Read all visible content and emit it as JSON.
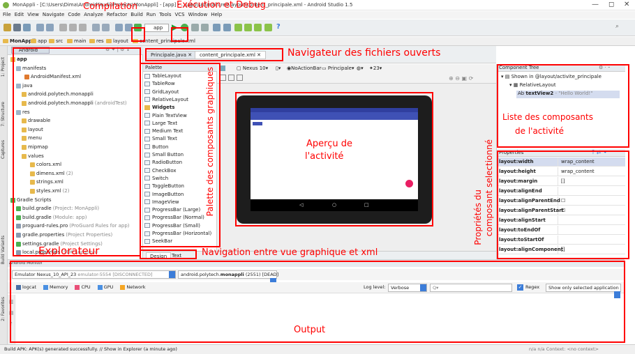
{
  "window": {
    "title": "MonAppli - [C:\\Users\\Dima\\AndroidStudioProjects\\MonAppli] - [app] - ...\\app\\src\\main\\res\\layout\\content_principale.xml - Android Studio 1.5",
    "min": "—",
    "max": "◻",
    "close": "✕"
  },
  "menu": [
    "File",
    "Edit",
    "View",
    "Navigate",
    "Code",
    "Analyze",
    "Refactor",
    "Build",
    "Run",
    "Tools",
    "VCS",
    "Window",
    "Help"
  ],
  "toolbar": {
    "config": "app"
  },
  "breadcrumbs": [
    "MonAppli",
    "app",
    "src",
    "main",
    "res",
    "layout",
    "content_principale.xml"
  ],
  "project": {
    "selector": "Android",
    "items": [
      {
        "label": "app",
        "extra": ""
      },
      {
        "label": "manifests",
        "extra": ""
      },
      {
        "label": "AndroidManifest.xml",
        "extra": ""
      },
      {
        "label": "java",
        "extra": ""
      },
      {
        "label": "android.polytech.monappli",
        "extra": ""
      },
      {
        "label": "android.polytech.monappli",
        "extra": "(androidTest)"
      },
      {
        "label": "res",
        "extra": ""
      },
      {
        "label": "drawable",
        "extra": ""
      },
      {
        "label": "layout",
        "extra": ""
      },
      {
        "label": "menu",
        "extra": ""
      },
      {
        "label": "mipmap",
        "extra": ""
      },
      {
        "label": "values",
        "extra": ""
      },
      {
        "label": "colors.xml",
        "extra": ""
      },
      {
        "label": "dimens.xml",
        "extra": "(2)"
      },
      {
        "label": "strings.xml",
        "extra": ""
      },
      {
        "label": "styles.xml",
        "extra": "(2)"
      },
      {
        "label": "Gradle Scripts",
        "extra": ""
      },
      {
        "label": "build.gradle",
        "extra": "(Project: MonAppli)"
      },
      {
        "label": "build.gradle",
        "extra": "(Module: app)"
      },
      {
        "label": "proguard-rules.pro",
        "extra": "(ProGuard Rules for app)"
      },
      {
        "label": "gradle.properties",
        "extra": "(Project Properties)"
      },
      {
        "label": "settings.gradle",
        "extra": "(Project Settings)"
      },
      {
        "label": "local.properties",
        "extra": "(SDK Location)"
      }
    ]
  },
  "left_tabs": [
    "1: Project",
    "7: Structure",
    "Captures",
    "Build Variants",
    "2: Favorites"
  ],
  "editor_tabs": [
    "Principale.java",
    "content_principale.xml"
  ],
  "palette": {
    "title": "Palette",
    "items": [
      "TableLayout",
      "TableRow",
      "GridLayout",
      "RelativeLayout",
      "Widgets",
      "Plain TextView",
      "Large Text",
      "Medium Text",
      "Small Text",
      "Button",
      "Small Button",
      "RadioButton",
      "CheckBox",
      "Switch",
      "ToggleButton",
      "ImageButton",
      "ImageView",
      "ProgressBar (Large)",
      "ProgressBar (Normal)",
      "ProgressBar (Small)",
      "ProgressBar (Horizontal)",
      "SeekBar"
    ]
  },
  "design_toolbar": {
    "device": "Nexus 10",
    "theme": "NoActionBar",
    "activity": "Principale",
    "api": "23"
  },
  "design_tabs": [
    "Design",
    "Text"
  ],
  "component_tree": {
    "title": "Component Tree",
    "items": [
      "Shown in @layout/activite_principale",
      "RelativeLayout"
    ],
    "selected_name": "textView2",
    "selected_value": "- \"Hello World!\""
  },
  "properties": {
    "title": "Properties",
    "rows": [
      {
        "k": "layout:width",
        "v": "wrap_content"
      },
      {
        "k": "layout:height",
        "v": "wrap_content"
      },
      {
        "k": "layout:margin",
        "v": "[]"
      },
      {
        "k": "layout:alignEnd",
        "v": ""
      },
      {
        "k": "layout:alignParentEnd",
        "v": "☐"
      },
      {
        "k": "layout:alignParentStart",
        "v": "☐"
      },
      {
        "k": "layout:alignStart",
        "v": ""
      },
      {
        "k": "layout:toEndOf",
        "v": ""
      },
      {
        "k": "layout:toStartOf",
        "v": ""
      },
      {
        "k": "layout:alignComponent",
        "v": "[]"
      }
    ]
  },
  "monitor": {
    "title": "Android Monitor",
    "device": "Emulator Nexus_10_API_23",
    "device_extra": "emulator-5554 [DISCONNECTED]",
    "process_pre": "android.polytech.",
    "process_bold": "monappli",
    "process_post": "(2551) [DEAD]",
    "tabs": [
      "logcat",
      "Memory",
      "CPU",
      "GPU",
      "Network"
    ],
    "loglevel_label": "Log level:",
    "loglevel": "Verbose",
    "search_placeholder": "Q▾",
    "regex": "Regex",
    "filter": "Show only selected application"
  },
  "status": {
    "text": "Build APK: APK(s) generated successfully. // Show in Explorer (a minute ago)",
    "right": "n/a   n/a   Context: <no context>"
  },
  "annotations": {
    "compilation": "Compilation",
    "execution": "Exécution et Debug",
    "navigator": "Navigateur des fichiers ouverts",
    "components_list_1": "Liste des composants",
    "components_list_2": "de l'activité",
    "preview_1": "Aperçu de",
    "preview_2": "l'activité",
    "palette": "Palette des composants graphiques",
    "properties_1": "Propriétés du",
    "properties_2": "composant selectionné",
    "explorer": "Explorateur",
    "design_nav": "Navigation entre vue graphique et xml",
    "output": "Output"
  },
  "colors": {
    "annotation": "#ff0000",
    "accent": "#3c7dd9",
    "app_bar": "#3f51b5"
  }
}
